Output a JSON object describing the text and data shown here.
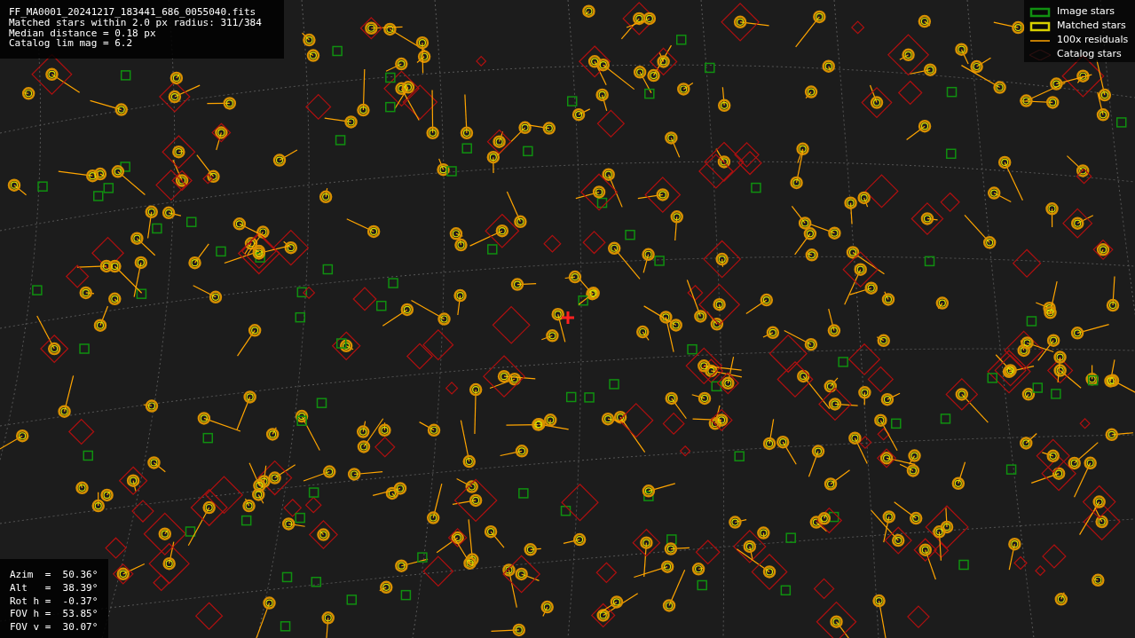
{
  "info_lines": [
    "FF_MA0001_20241217_183441_686_0055040.fits",
    "Matched stars within 2.0 px radius: 311/384",
    "Median distance = 0.18 px",
    "Catalog lim mag = 6.2"
  ],
  "legend": [
    {
      "kind": "image",
      "label": "Image stars"
    },
    {
      "kind": "matched",
      "label": "Matched stars"
    },
    {
      "kind": "residual",
      "label": "100x residuals"
    },
    {
      "kind": "catalog",
      "label": "Catalog stars"
    }
  ],
  "pointing": [
    "Azim  =  50.36°",
    "Alt   =  38.39°",
    "Rot h =  -0.37°",
    "FOV h =  53.85°",
    "FOV v =  30.07°"
  ]
}
